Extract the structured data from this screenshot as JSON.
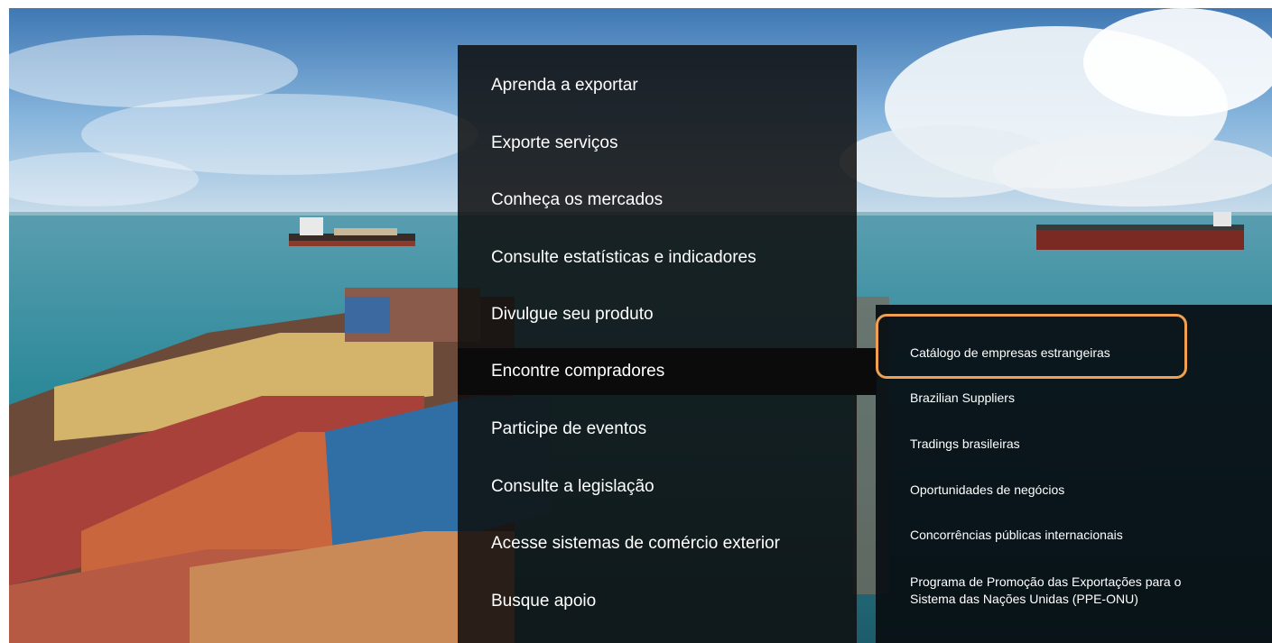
{
  "main_menu": {
    "items": [
      {
        "label": "Aprenda a exportar"
      },
      {
        "label": "Exporte serviços"
      },
      {
        "label": "Conheça os mercados"
      },
      {
        "label": "Consulte estatísticas e indicadores"
      },
      {
        "label": "Divulgue seu produto"
      },
      {
        "label": "Encontre compradores",
        "active": true
      },
      {
        "label": "Participe de eventos"
      },
      {
        "label": "Consulte a legislação"
      },
      {
        "label": "Acesse sistemas de comércio exterior"
      },
      {
        "label": "Busque apoio"
      }
    ]
  },
  "submenu": {
    "items": [
      {
        "label": "Catálogo de empresas estrangeiras",
        "highlighted": true
      },
      {
        "label": "Brazilian Suppliers"
      },
      {
        "label": "Tradings brasileiras"
      },
      {
        "label": "Oportunidades de negócios"
      },
      {
        "label": "Concorrências públicas internacionais"
      },
      {
        "label": "Programa de Promoção das Exportações para o Sistema das Nações Unidas (PPE-ONU)"
      }
    ]
  },
  "colors": {
    "highlight_border": "#f0a050",
    "menu_background": "#0e0e0e",
    "text": "#ffffff"
  }
}
